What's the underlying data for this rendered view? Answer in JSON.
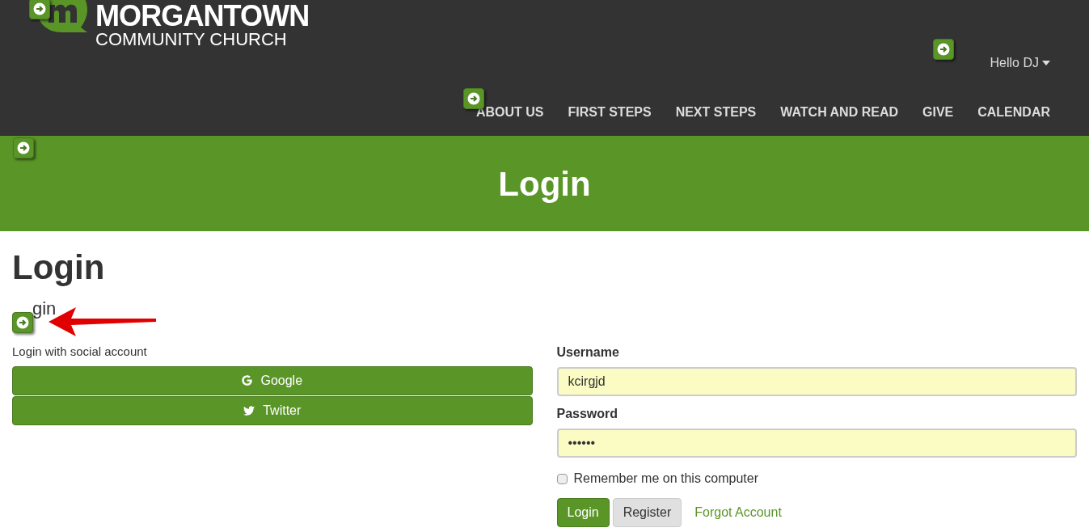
{
  "header": {
    "logo": {
      "name": "MORGANTOWN",
      "tagline": "COMMUNITY CHURCH"
    },
    "user_menu": "Hello DJ",
    "nav": [
      {
        "label": "ABOUT US"
      },
      {
        "label": "FIRST STEPS"
      },
      {
        "label": "NEXT STEPS"
      },
      {
        "label": "WATCH AND READ"
      },
      {
        "label": "GIVE"
      },
      {
        "label": "CALENDAR"
      }
    ]
  },
  "banner": {
    "title": "Login"
  },
  "page": {
    "title": "Login",
    "subtitle": "gin"
  },
  "social": {
    "label": "Login with social account",
    "buttons": [
      {
        "kind": "google",
        "label": "Google"
      },
      {
        "kind": "twitter",
        "label": "Twitter"
      }
    ]
  },
  "form": {
    "username": {
      "label": "Username",
      "value": "kcirgjd"
    },
    "password": {
      "label": "Password",
      "value": "••••••"
    },
    "remember": {
      "label": "Remember me on this computer",
      "checked": false
    },
    "buttons": [
      {
        "kind": "primary",
        "label": "Login"
      },
      {
        "kind": "secondary",
        "label": "Register"
      },
      {
        "kind": "link",
        "label": "Forgot Account"
      }
    ]
  }
}
